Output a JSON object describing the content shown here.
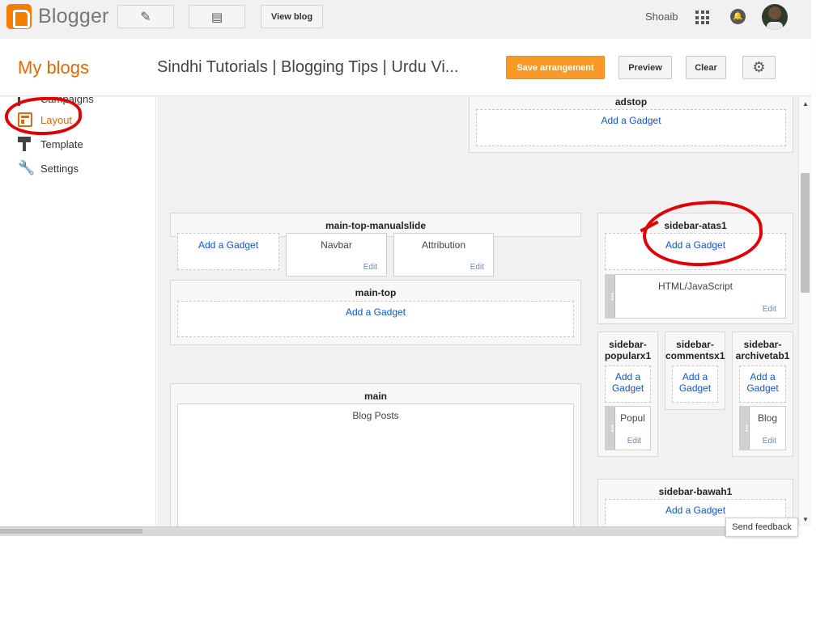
{
  "topbar": {
    "logo_text": "Blogger",
    "view_blog_label": "View blog",
    "user_name": "Shoaib"
  },
  "header": {
    "my_blogs": "My blogs",
    "blog_title": "Sindhi Tutorials | Blogging Tips | Urdu Vi...",
    "save_label": "Save arrangement",
    "preview_label": "Preview",
    "clear_label": "Clear"
  },
  "sidebar": {
    "items": [
      {
        "label": "Campaigns",
        "icon": "campaigns-icon"
      },
      {
        "label": "Layout",
        "icon": "layout-icon",
        "active": true
      },
      {
        "label": "Template",
        "icon": "template-icon"
      },
      {
        "label": "Settings",
        "icon": "wrench-icon"
      }
    ]
  },
  "layout": {
    "add_gadget": "Add a Gadget",
    "edit": "Edit",
    "sections": {
      "adstop": "adstop",
      "main_top_manualslide": "main-top-manualslide",
      "main_top": "main-top",
      "main": "main",
      "sidebar_atas1": "sidebar-atas1",
      "sidebar_popularx1": "sidebar-\npopularx1",
      "sidebar_commentsx1": "sidebar-\ncommentsx1",
      "sidebar_archivetab1": "sidebar-\narchivetab1",
      "sidebar_bawah1": "sidebar-bawah1"
    },
    "widgets": {
      "navbar": "Navbar",
      "attribution": "Attribution",
      "blog_posts": "Blog Posts",
      "html_js": "HTML/JavaScript",
      "popul": "Popul",
      "blog": "Blog"
    },
    "add_gadget_split": "Add a\nGadget"
  },
  "footer": {
    "send_feedback": "Send feedback"
  },
  "colors": {
    "accent": "#dd6a06",
    "save_button": "#f99a28",
    "link": "#1155cc",
    "annotation": "#e00000"
  }
}
